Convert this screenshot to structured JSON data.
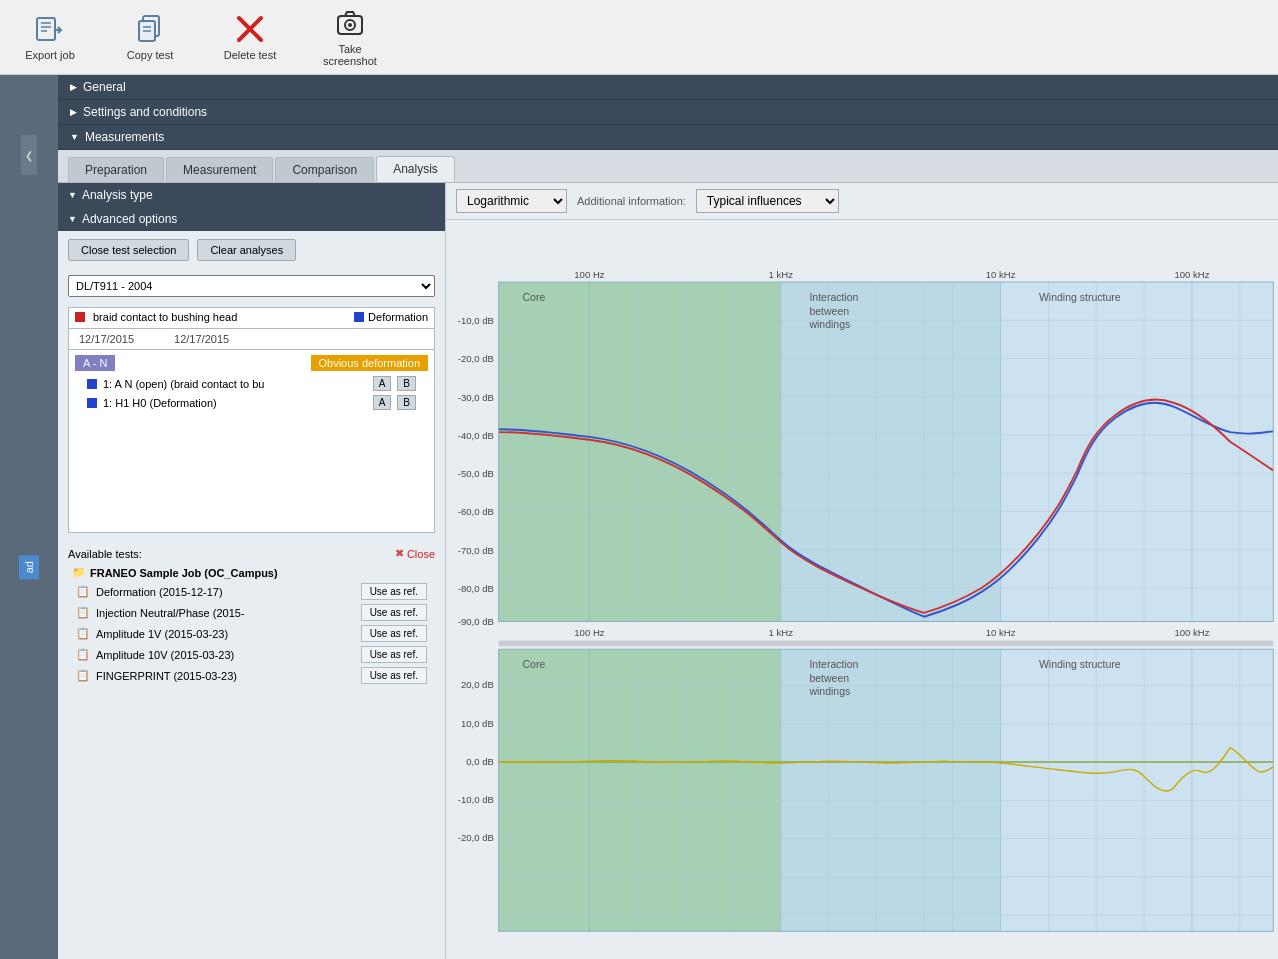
{
  "toolbar": {
    "export_label": "Export job",
    "copy_label": "Copy test",
    "delete_label": "Delete test",
    "screenshot_label": "Take screenshot"
  },
  "left_strip": {
    "load_label": "ad"
  },
  "accordion": {
    "general": "General",
    "settings": "Settings and conditions",
    "measurements": "Measurements"
  },
  "tabs": [
    {
      "label": "Preparation",
      "active": false
    },
    {
      "label": "Measurement",
      "active": false
    },
    {
      "label": "Comparison",
      "active": false
    },
    {
      "label": "Analysis",
      "active": true
    }
  ],
  "left_panel": {
    "analysis_type_label": "Analysis type",
    "advanced_options_label": "Advanced options",
    "close_test_btn": "Close test selection",
    "clear_analyses_btn": "Clear analyses",
    "test_selector_value": "DL/T911 - 2004",
    "legend": {
      "entry1": "braid contact to bushing head",
      "entry2": "Deformation",
      "date1": "12/17/2015",
      "date2": "12/17/2015",
      "group": "A - N",
      "result": "Obvious deformation",
      "meas1": "1: A N (open) (braid contact to bu",
      "meas2": "1: H1 H0 (Deformation)"
    }
  },
  "available_tests": {
    "title": "Available tests:",
    "close_label": "Close",
    "group": "FRANEO Sample Job (OC_Campus)",
    "items": [
      {
        "name": "Deformation (2015-12-17)",
        "btn": "Use as ref."
      },
      {
        "name": "Injection Neutral/Phase (2015-",
        "btn": "Use as ref."
      },
      {
        "name": "Amplitude 1V (2015-03-23)",
        "btn": "Use as ref."
      },
      {
        "name": "Amplitude 10V (2015-03-23)",
        "btn": "Use as ref."
      },
      {
        "name": "FINGERPRINT (2015-03-23)",
        "btn": "Use as ref."
      }
    ]
  },
  "chart": {
    "scale_label": "Logarithmic",
    "additional_info_label": "Additional information:",
    "additional_info_value": "Typical influences",
    "top_chart": {
      "y_labels": [
        "-10,0 dB",
        "-20,0 dB",
        "-30,0 dB",
        "-40,0 dB",
        "-50,0 dB",
        "-60,0 dB",
        "-70,0 dB",
        "-80,0 dB",
        "-90,0 dB"
      ],
      "x_labels_top": [
        "100 Hz",
        "1 kHz",
        "10 kHz",
        "100 kHz"
      ],
      "x_labels_bot": [
        "100 Hz",
        "1 kHz",
        "10 kHz",
        "100 kHz"
      ],
      "region1": "Core",
      "region2_line1": "Interaction",
      "region2_line2": "between",
      "region2_line3": "windings",
      "region3": "Winding structure"
    },
    "bottom_chart": {
      "y_labels": [
        "20,0 dB",
        "10,0 dB",
        "0,0 dB",
        "-10,0 dB",
        "-20,0 dB"
      ],
      "region1": "Core",
      "region2_line1": "Interaction",
      "region2_line2": "between",
      "region2_line3": "windings",
      "region3": "Winding structure"
    }
  }
}
